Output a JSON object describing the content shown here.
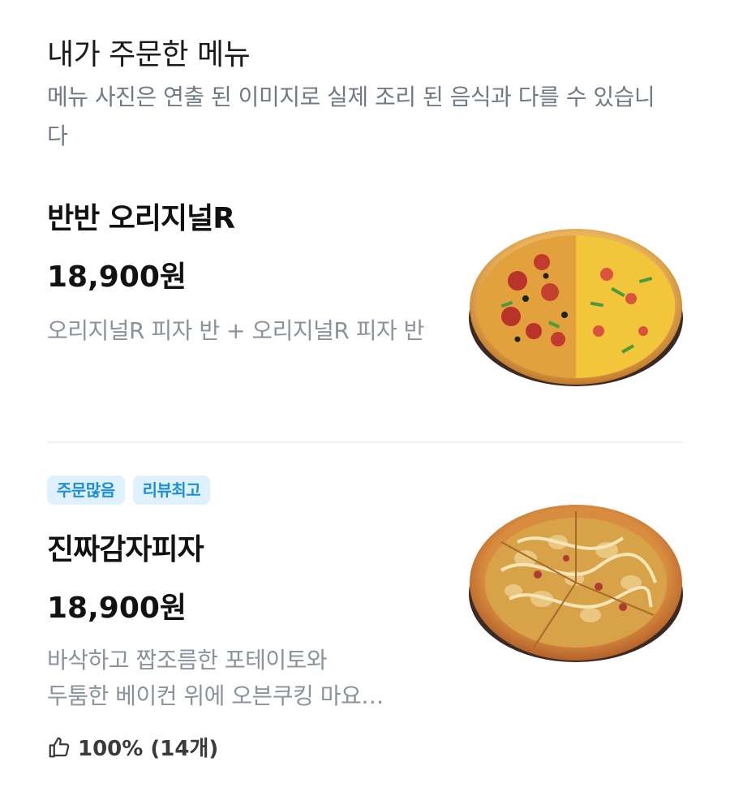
{
  "header": {
    "title": "내가 주문한 메뉴",
    "description": "메뉴 사진은 연출 된 이미지로 실제 조리 된 음식과 다를 수 있습니다"
  },
  "items": [
    {
      "name": "반반 오리지널R",
      "price": "18,900원",
      "description": "오리지널R 피자 반 + 오리지널R 피자 반"
    },
    {
      "badges": [
        "주문많음",
        "리뷰최고"
      ],
      "name": "진짜감자피자",
      "price": "18,900원",
      "description_lines": [
        "바삭하고 짭조름한 포테이토와",
        "두툼한 베이컨 위에 오븐쿠킹 마요…"
      ],
      "rating": "100% (14개)",
      "rating_icon": "thumbs-up-icon"
    }
  ],
  "colors": {
    "badge_bg": "#dff1fc",
    "badge_text": "#1e8fd6",
    "secondary_text": "#8a929c"
  }
}
